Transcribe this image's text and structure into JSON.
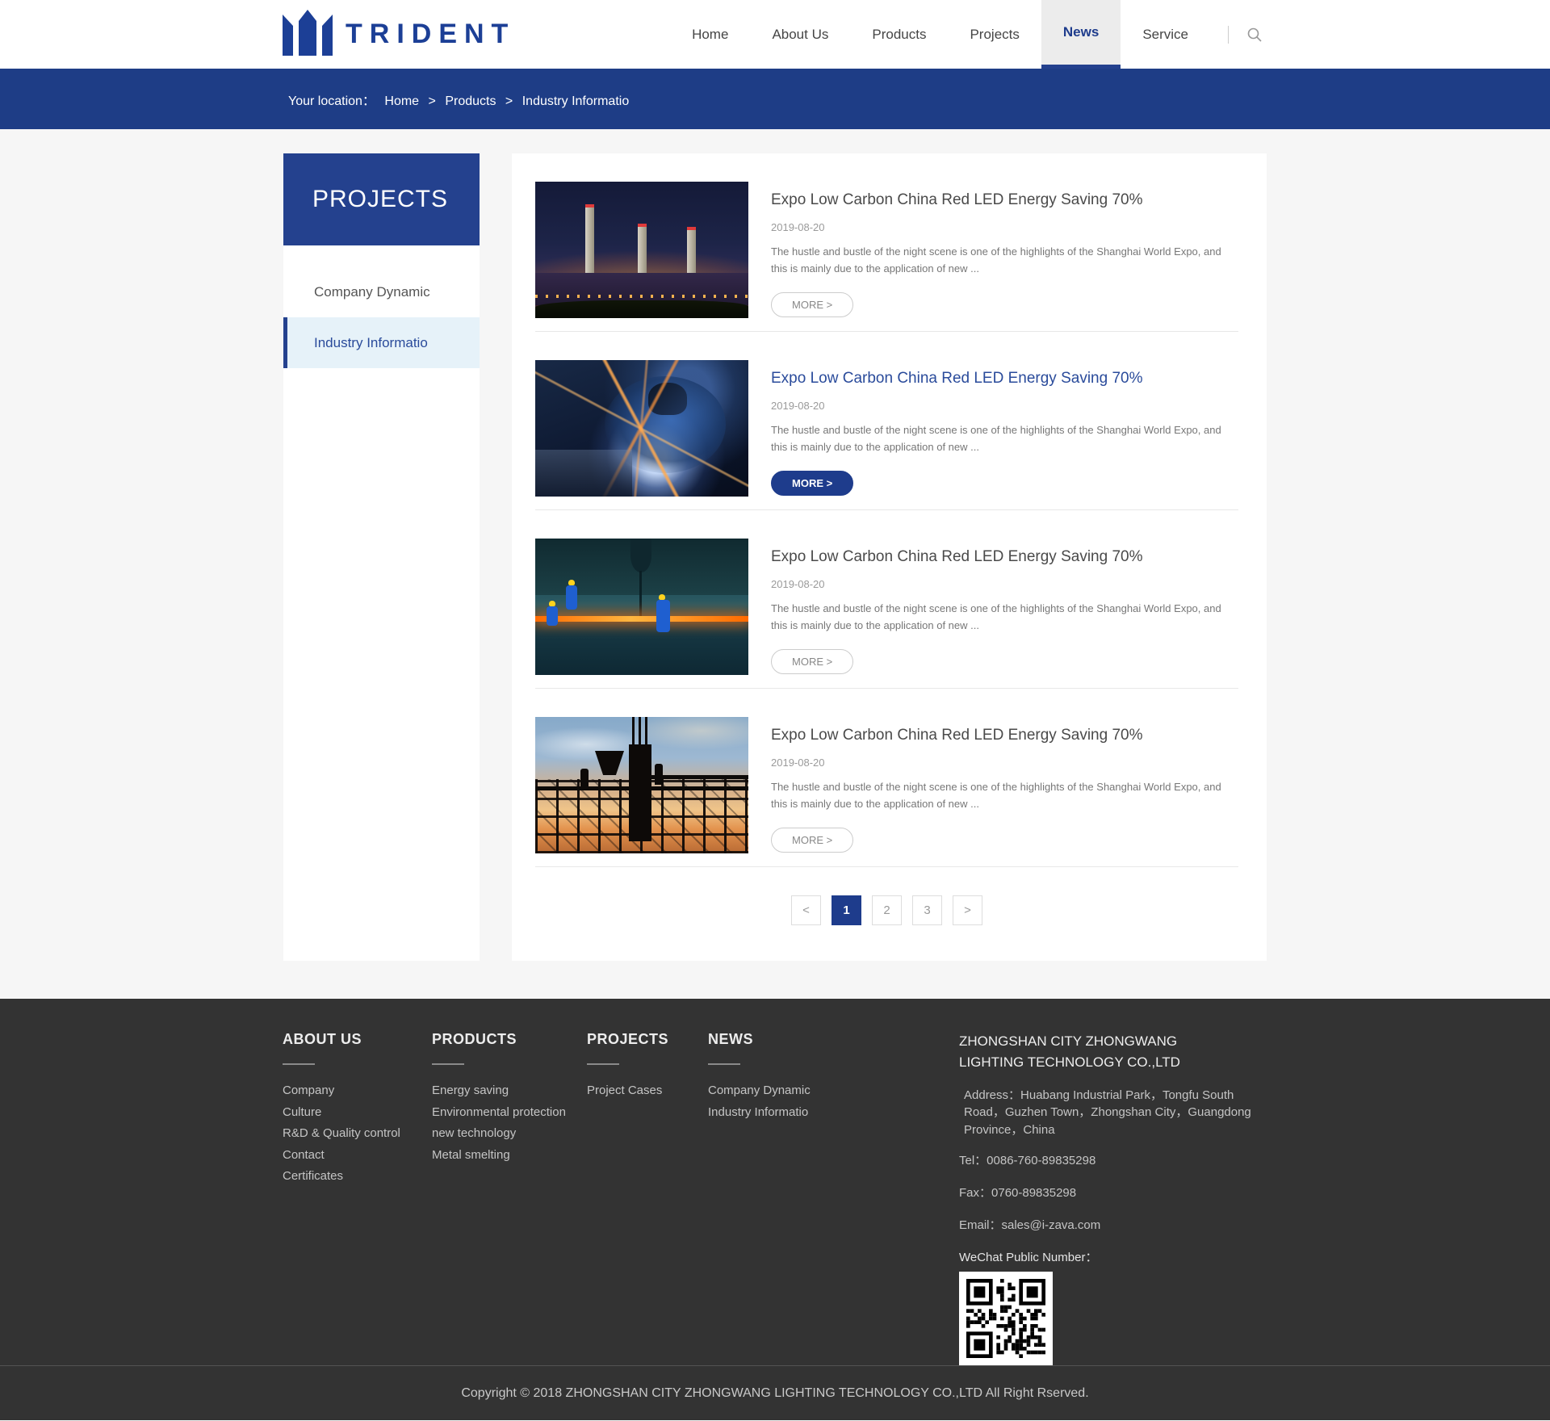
{
  "brand": {
    "name": "TRIDENT",
    "logo_icon": "trident-icon",
    "color": "#1c3f96"
  },
  "nav": {
    "items": [
      {
        "label": "Home",
        "active": false
      },
      {
        "label": "About Us",
        "active": false
      },
      {
        "label": "Products",
        "active": false
      },
      {
        "label": "Projects",
        "active": false
      },
      {
        "label": "News",
        "active": true
      },
      {
        "label": "Service",
        "active": false
      }
    ],
    "search_icon": "search-icon"
  },
  "breadcrumb": {
    "label": "Your location：",
    "separator": ">",
    "items": [
      "Home",
      "Products",
      "Industry Informatio"
    ]
  },
  "sidebar": {
    "title": "PROJECTS",
    "items": [
      {
        "label": "Company Dynamic",
        "active": false
      },
      {
        "label": "Industry Informatio",
        "active": true
      }
    ]
  },
  "news": {
    "items": [
      {
        "title": "Expo Low Carbon China Red LED Energy Saving 70%",
        "date": "2019-08-20",
        "excerpt": "The hustle and bustle of the night scene is one of the highlights of the Shanghai World Expo, and this is mainly due to the application of new ...",
        "more_label": "MORE >",
        "highlighted": false,
        "image": "power-plant-night-photo"
      },
      {
        "title": "Expo Low Carbon China Red LED Energy Saving 70%",
        "date": "2019-08-20",
        "excerpt": "The hustle and bustle of the night scene is one of the highlights of the Shanghai World Expo, and this is mainly due to the application of new ...",
        "more_label": "MORE >",
        "highlighted": true,
        "image": "welding-sparks-photo"
      },
      {
        "title": "Expo Low Carbon China Red LED Energy Saving 70%",
        "date": "2019-08-20",
        "excerpt": "The hustle and bustle of the night scene is one of the highlights of the Shanghai World Expo, and this is mainly due to the application of new ...",
        "more_label": "MORE >",
        "highlighted": false,
        "image": "steel-mill-workers-photo"
      },
      {
        "title": "Expo Low Carbon China Red LED Energy Saving 70%",
        "date": "2019-08-20",
        "excerpt": "The hustle and bustle of the night scene is one of the highlights of the Shanghai World Expo, and this is mainly due to the application of new ...",
        "more_label": "MORE >",
        "highlighted": false,
        "image": "construction-sunset-photo"
      }
    ]
  },
  "pagination": {
    "prev": "<",
    "next": ">",
    "pages": [
      "1",
      "2",
      "3"
    ],
    "active_page": "1"
  },
  "footer": {
    "columns": [
      {
        "title": "ABOUT US",
        "links": [
          "Company",
          "Culture",
          "R&D & Quality control",
          "Contact",
          "Certificates"
        ]
      },
      {
        "title": "PRODUCTS",
        "links": [
          "Energy saving",
          "Environmental protection",
          "new technology",
          "Metal smelting"
        ]
      },
      {
        "title": "PROJECTS",
        "links": [
          "Project Cases"
        ]
      },
      {
        "title": "NEWS",
        "links": [
          "Company Dynamic",
          "Industry Informatio"
        ]
      }
    ],
    "company": {
      "name": "ZHONGSHAN CITY ZHONGWANG LIGHTING TECHNOLOGY CO.,LTD",
      "address": "Address：Huabang Industrial Park，Tongfu South Road，Guzhen Town，Zhongshan City，Guangdong Province，China",
      "tel": "Tel：0086-760-89835298",
      "fax": "Fax：0760-89835298",
      "email": "Email：sales@i-zava.com",
      "wechat_label": "WeChat Public Number：",
      "qr_icon": "wechat-qr-code"
    },
    "copyright": "Copyright © 2018 ZHONGSHAN CITY ZHONGWANG LIGHTING TECHNOLOGY CO.,LTD All Right Rserved."
  },
  "colors": {
    "accent": "#24418e",
    "band_blue": "#1e3d86",
    "active_fill": "#1e3c8c",
    "page_bg": "#f6f6f6",
    "footer_bg": "#333333"
  }
}
